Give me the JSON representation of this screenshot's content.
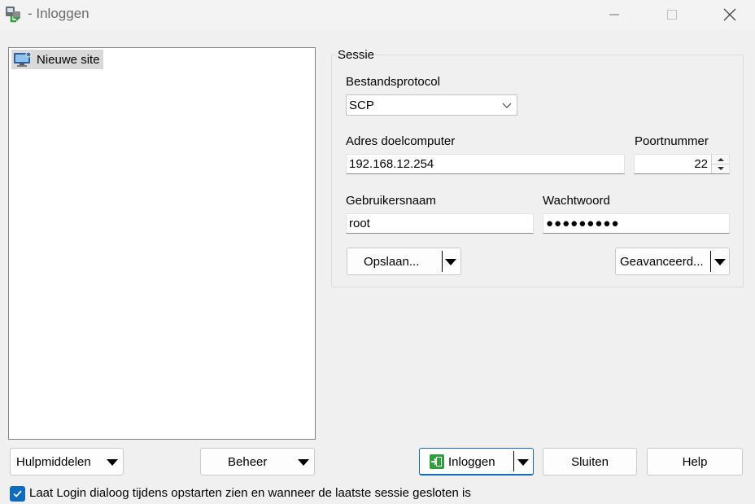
{
  "window": {
    "title": "- Inloggen",
    "icons": {
      "app": "winscp-icon",
      "minimize": "minimize-icon",
      "maximize": "maximize-icon",
      "close": "close-icon"
    }
  },
  "site_tree": {
    "items": [
      {
        "label": "Nieuwe site",
        "icon": "new-site-monitor-icon"
      }
    ]
  },
  "session": {
    "legend": "Sessie",
    "protocol_label": "Bestandsprotocol",
    "protocol_value": "SCP",
    "host_label": "Adres doelcomputer",
    "host_value": "192.168.12.254",
    "port_label": "Poortnummer",
    "port_value": "22",
    "user_label": "Gebruikersnaam",
    "user_value": "root",
    "password_label": "Wachtwoord",
    "password_value": "●●●●●●●●●",
    "save_label": "Opslaan...",
    "advanced_label": "Geavanceerd..."
  },
  "footer": {
    "tools_label": "Hulpmiddelen",
    "manage_label": "Beheer",
    "login_label": "Inloggen",
    "close_label": "Sluiten",
    "help_label": "Help",
    "startup_checkbox_label": "Laat Login dialoog tijdens opstarten zien en wanneer de laatste sessie gesloten is",
    "startup_checkbox_checked": true
  },
  "colors": {
    "accent": "#0f6cbd",
    "login_icon": "#2e9e3e"
  }
}
